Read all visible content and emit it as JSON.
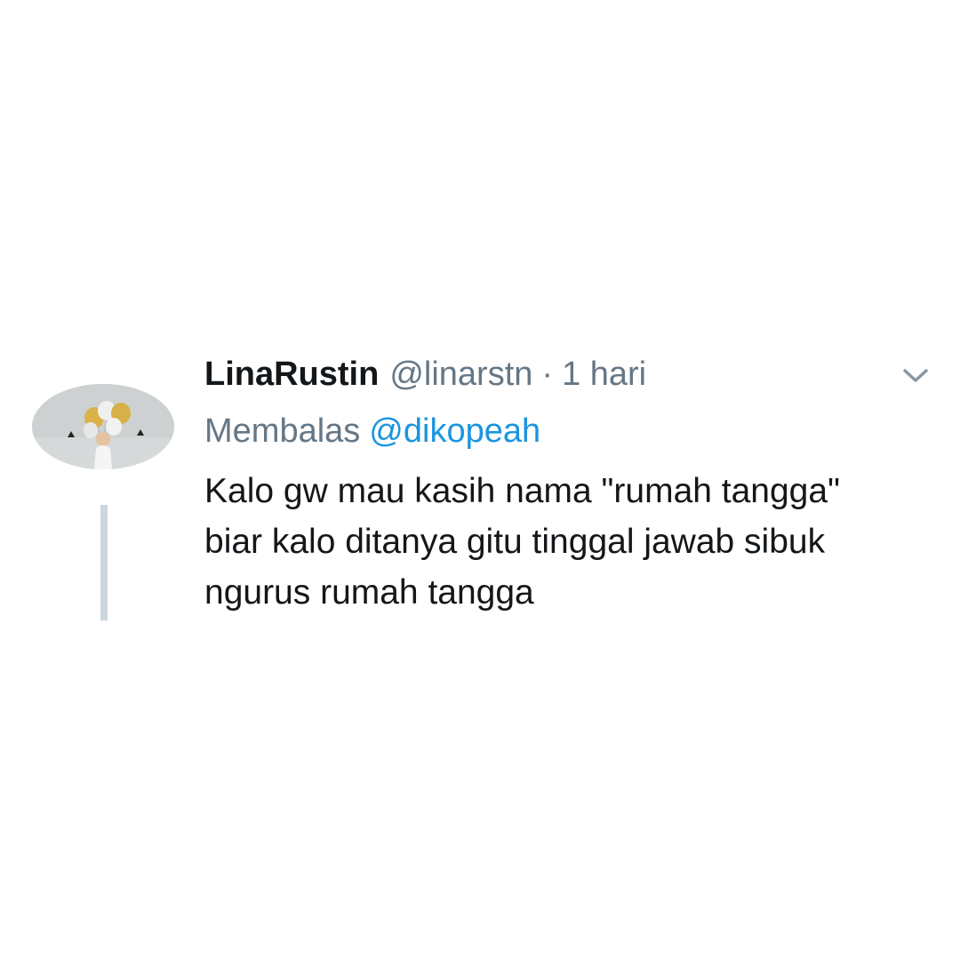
{
  "tweet": {
    "author_name": "LinaRustin",
    "author_handle": "@linarstn",
    "separator": "·",
    "timestamp": "1 hari",
    "reply_prefix": "Membalas",
    "reply_to": "@dikopeah",
    "text_lines": [
      "Kalo gw mau kasih nama \"rumah tangga\"",
      "biar kalo ditanya gitu tinggal jawab sibuk",
      "ngurus rumah tangga"
    ],
    "avatar_icon": "avatar-photo-balloons",
    "menu_icon": "chevron-down-icon"
  },
  "colors": {
    "name": "#14171a",
    "meta": "#657786",
    "link": "#1b95e0",
    "thread_line": "#ccd6dd",
    "background": "#ffffff"
  }
}
